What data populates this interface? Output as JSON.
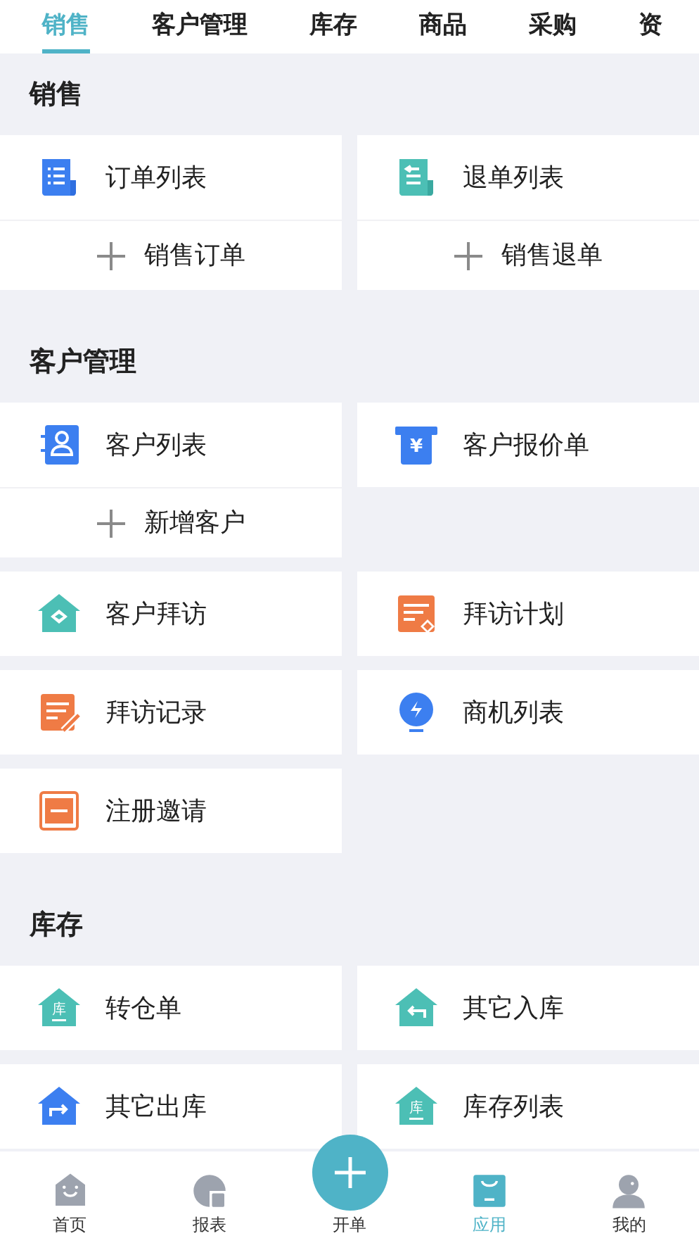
{
  "tabs": [
    {
      "label": "销售",
      "selected": true
    },
    {
      "label": "客户管理",
      "selected": false
    },
    {
      "label": "库存",
      "selected": false
    },
    {
      "label": "商品",
      "selected": false
    },
    {
      "label": "采购",
      "selected": false
    },
    {
      "label": "资",
      "selected": false
    }
  ],
  "sections": [
    {
      "title": "销售",
      "cards": [
        {
          "label": "订单列表",
          "kind": "list-doc",
          "action": "销售订单"
        },
        {
          "label": "退单列表",
          "kind": "return-doc",
          "action": "销售退单"
        }
      ]
    },
    {
      "title": "客户管理",
      "cards": [
        {
          "label": "客户列表",
          "kind": "contact",
          "action": "新增客户"
        },
        {
          "label": "客户报价单",
          "kind": "quote",
          "icon_label": "¥"
        },
        {
          "label": "客户拜访",
          "kind": "house-tag"
        },
        {
          "label": "拜访计划",
          "kind": "plan"
        },
        {
          "label": "拜访记录",
          "kind": "record"
        },
        {
          "label": "商机列表",
          "kind": "bulb"
        },
        {
          "label": "注册邀请",
          "kind": "frame"
        }
      ]
    },
    {
      "title": "库存",
      "cards": [
        {
          "label": "转仓单",
          "kind": "house-label",
          "icon_label": "库"
        },
        {
          "label": "其它入库",
          "kind": "house-in"
        },
        {
          "label": "其它出库",
          "kind": "house-out"
        },
        {
          "label": "库存列表",
          "kind": "house-label",
          "icon_label": "库"
        }
      ]
    }
  ],
  "nav": [
    {
      "label": "首页",
      "kind": "home",
      "selected": false
    },
    {
      "label": "报表",
      "kind": "report",
      "selected": false
    },
    {
      "label": "开单",
      "kind": "fab",
      "selected": false
    },
    {
      "label": "应用",
      "kind": "apps",
      "selected": true
    },
    {
      "label": "我的",
      "kind": "person",
      "selected": false
    }
  ]
}
